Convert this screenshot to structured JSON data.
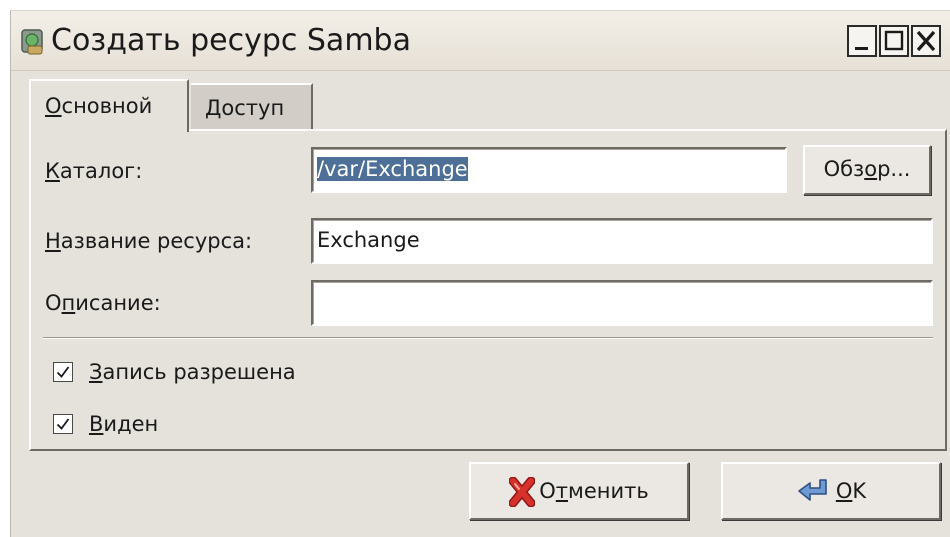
{
  "window": {
    "title": "Создать ресурс Samba",
    "icon": "samba-share-icon",
    "controls": {
      "minimize": "minimize-icon",
      "maximize": "maximize-icon",
      "close": "close-icon"
    }
  },
  "tabs": [
    {
      "label_pre": "",
      "label_mnemonic": "О",
      "label_post": "сновной",
      "active": true
    },
    {
      "label_pre": "",
      "label_mnemonic": "Д",
      "label_post": "оступ",
      "active": false
    }
  ],
  "form": {
    "directory": {
      "label_pre": "",
      "label_mnemonic": "К",
      "label_post": "аталог:",
      "value": "/var/Exchange",
      "selected": true
    },
    "browse_button": {
      "label_pre": "Обз",
      "label_mnemonic": "о",
      "label_post": "р..."
    },
    "share_name": {
      "label_pre": "",
      "label_mnemonic": "Н",
      "label_post": "азвание ресурса:",
      "value": "Exchange"
    },
    "description": {
      "label_pre": "О",
      "label_mnemonic": "п",
      "label_post": "исание:",
      "value": ""
    },
    "writable": {
      "label_pre": "",
      "label_mnemonic": "З",
      "label_post": "апись разрешена",
      "checked": true
    },
    "visible": {
      "label_pre": "",
      "label_mnemonic": "В",
      "label_post": "иден",
      "checked": true
    }
  },
  "buttons": {
    "cancel": {
      "label_pre": "О",
      "label_mnemonic": "т",
      "label_post": "менить",
      "icon": "cancel-x-icon"
    },
    "ok": {
      "label_pre": "",
      "label_mnemonic": "O",
      "label_post": "K",
      "icon": "enter-arrow-icon"
    }
  },
  "colors": {
    "selection": "#4d6f98",
    "cancel_icon": "#d8302a",
    "ok_icon": "#6d9ad3"
  }
}
